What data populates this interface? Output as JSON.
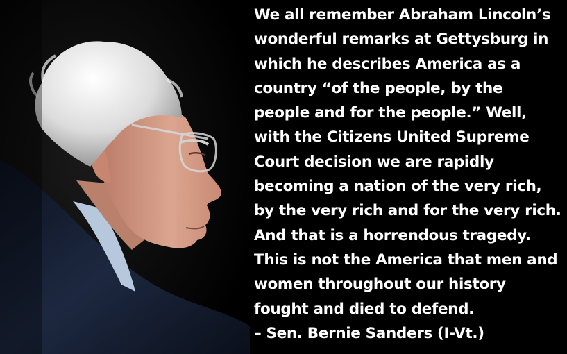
{
  "quote": {
    "lines": [
      "We all remember Abraham Lincoln’s",
      "wonderful remarks at Gettysburg in",
      "which he describes America as a",
      "country “of the people, by the",
      "people and for the people.”  Well,",
      "with the Citizens United Supreme",
      "Court decision we are rapidly",
      "becoming a nation of the very rich,",
      "by the very rich and for the very rich.",
      "And that is a horrendous tragedy.",
      "This is not the America that men and",
      "women throughout our history",
      "fought and died to defend."
    ],
    "attribution": "– Sen. Bernie Sanders (I-Vt.)"
  },
  "colors": {
    "background": "#000000",
    "text": "#ffffff",
    "hair": "#e6e6e6",
    "skin": "#d9a08a",
    "suit": "#1b2436",
    "shirt": "#b7c7dc"
  }
}
